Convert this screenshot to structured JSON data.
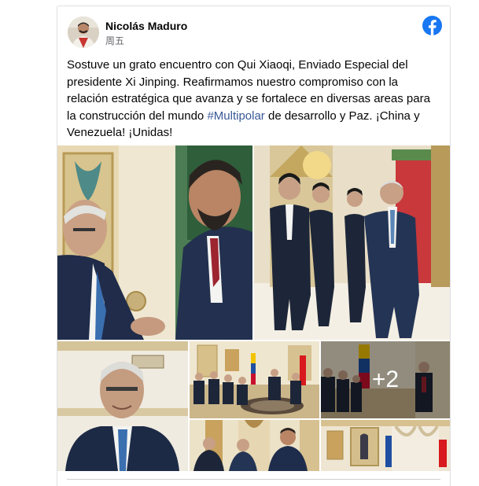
{
  "post": {
    "author": "Nicolás Maduro",
    "timestamp": "周五",
    "text_before": "Sostuve un grato encuentro con Qui Xiaoqi, Enviado Especial del presidente Xi Jinping. Reafirmamos nuestro compromiso con la relación estratégica que avanza y se fortalece en diversas areas para la construcción del mundo ",
    "hashtag": "#Multipolar",
    "text_after": " de desarrollo y Paz. ¡China y Venezuela! ¡Unidas!",
    "more_photos": "+2"
  },
  "photos": [
    {
      "name": "handshake-photo"
    },
    {
      "name": "walking-delegation-photo"
    },
    {
      "name": "envoy-portrait-photo"
    },
    {
      "name": "meeting-hall-photo"
    },
    {
      "name": "meeting-flags-photo"
    },
    {
      "name": "greeting-photo"
    },
    {
      "name": "palace-hall-photo"
    }
  ],
  "colors": {
    "facebook_blue": "#1877f2",
    "hashtag_link": "#385898",
    "secondary_text": "#65676b"
  }
}
